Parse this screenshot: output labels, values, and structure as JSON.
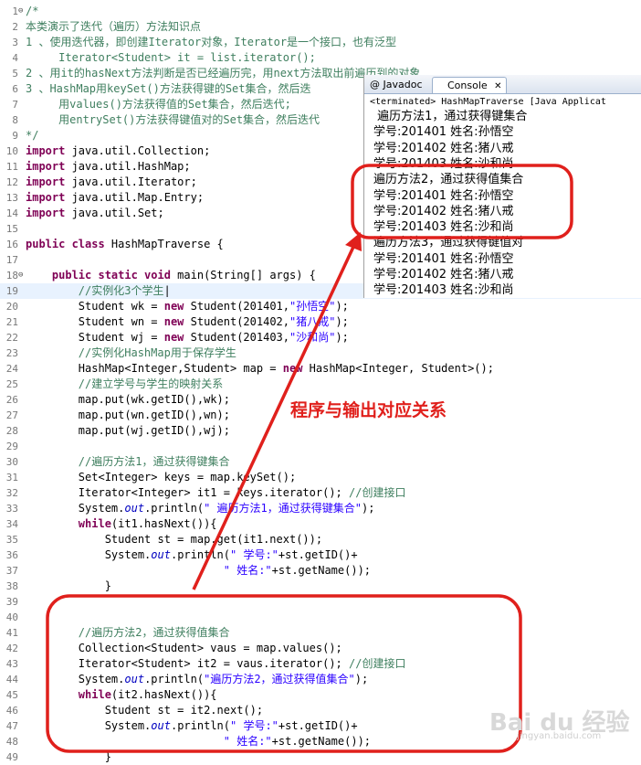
{
  "editor": {
    "lines": [
      {
        "n": "1",
        "fold": "⊖",
        "segs": [
          [
            "cm",
            "/*"
          ]
        ]
      },
      {
        "n": "2",
        "segs": [
          [
            "cm",
            "本类演示了迭代（遍历）方法知识点"
          ]
        ]
      },
      {
        "n": "3",
        "segs": [
          [
            "cm",
            "1 、使用迭代器，即创建Iterator对象，Iterator是一个接口，也有泛型"
          ]
        ]
      },
      {
        "n": "4",
        "segs": [
          [
            "cm",
            "     Iterator<Student> it = list.iterator();"
          ]
        ]
      },
      {
        "n": "5",
        "segs": [
          [
            "cm",
            "2 、用it的hasNext方法判断是否已经遍历完，用next方法取出前遍历到的对象"
          ]
        ]
      },
      {
        "n": "6",
        "segs": [
          [
            "cm",
            "3 、HashMap用keySet()方法获得键的Set集合，然后迭"
          ]
        ]
      },
      {
        "n": "7",
        "segs": [
          [
            "cm",
            "     用values()方法获得值的Set集合，然后迭代;"
          ]
        ]
      },
      {
        "n": "8",
        "segs": [
          [
            "cm",
            "     用entrySet()方法获得键值对的Set集合，然后迭代"
          ]
        ]
      },
      {
        "n": "9",
        "segs": [
          [
            "cm",
            "*/"
          ]
        ]
      },
      {
        "n": "10",
        "segs": [
          [
            "kw",
            "import"
          ],
          [
            "tx",
            " java.util.Collection;"
          ]
        ]
      },
      {
        "n": "11",
        "segs": [
          [
            "kw",
            "import"
          ],
          [
            "tx",
            " java.util.HashMap;"
          ]
        ]
      },
      {
        "n": "12",
        "segs": [
          [
            "kw",
            "import"
          ],
          [
            "tx",
            " java.util.Iterator;"
          ]
        ]
      },
      {
        "n": "13",
        "segs": [
          [
            "kw",
            "import"
          ],
          [
            "tx",
            " java.util.Map.Entry;"
          ]
        ]
      },
      {
        "n": "14",
        "segs": [
          [
            "kw",
            "import"
          ],
          [
            "tx",
            " java.util.Set;"
          ]
        ]
      },
      {
        "n": "15",
        "segs": []
      },
      {
        "n": "16",
        "segs": [
          [
            "kw",
            "public class"
          ],
          [
            "tx",
            " HashMapTraverse {"
          ]
        ]
      },
      {
        "n": "17",
        "segs": []
      },
      {
        "n": "18",
        "fold": "⊖",
        "segs": [
          [
            "tx",
            "    "
          ],
          [
            "kw",
            "public static void"
          ],
          [
            "tx",
            " main(String[] args) {"
          ]
        ]
      },
      {
        "n": "19",
        "current": true,
        "segs": [
          [
            "cm",
            "        //实例化3个学生"
          ],
          [
            "tx",
            "|"
          ]
        ]
      },
      {
        "n": "20",
        "segs": [
          [
            "tx",
            "        Student wk = "
          ],
          [
            "kw",
            "new"
          ],
          [
            "tx",
            " Student(201401,"
          ],
          [
            "str",
            "\"孙悟空\""
          ],
          [
            "tx",
            ");"
          ]
        ]
      },
      {
        "n": "21",
        "segs": [
          [
            "tx",
            "        Student wn = "
          ],
          [
            "kw",
            "new"
          ],
          [
            "tx",
            " Student(201402,"
          ],
          [
            "str",
            "\"猪八戒\""
          ],
          [
            "tx",
            ");"
          ]
        ]
      },
      {
        "n": "22",
        "segs": [
          [
            "tx",
            "        Student wj = "
          ],
          [
            "kw",
            "new"
          ],
          [
            "tx",
            " Student(201403,"
          ],
          [
            "str",
            "\"沙和尚\""
          ],
          [
            "tx",
            ");"
          ]
        ]
      },
      {
        "n": "23",
        "segs": [
          [
            "cm",
            "        //实例化HashMap用于保存学生"
          ]
        ]
      },
      {
        "n": "24",
        "segs": [
          [
            "tx",
            "        HashMap<Integer,Student> map = "
          ],
          [
            "kw",
            "new"
          ],
          [
            "tx",
            " HashMap<Integer, Student>();"
          ]
        ]
      },
      {
        "n": "25",
        "segs": [
          [
            "cm",
            "        //建立学号与学生的映射关系"
          ]
        ]
      },
      {
        "n": "26",
        "segs": [
          [
            "tx",
            "        map.put(wk.getID(),wk);"
          ]
        ]
      },
      {
        "n": "27",
        "segs": [
          [
            "tx",
            "        map.put(wn.getID(),wn);"
          ]
        ]
      },
      {
        "n": "28",
        "segs": [
          [
            "tx",
            "        map.put(wj.getID(),wj);"
          ]
        ]
      },
      {
        "n": "29",
        "segs": []
      },
      {
        "n": "30",
        "segs": [
          [
            "cm",
            "        //遍历方法1，通过获得键集合"
          ]
        ]
      },
      {
        "n": "31",
        "segs": [
          [
            "tx",
            "        Set<Integer> keys = map.keySet();"
          ]
        ]
      },
      {
        "n": "32",
        "segs": [
          [
            "tx",
            "        Iterator<Integer> it1 = keys.iterator(); "
          ],
          [
            "cm",
            "//创建接口"
          ]
        ]
      },
      {
        "n": "33",
        "segs": [
          [
            "tx",
            "        System."
          ],
          [
            "it",
            "out"
          ],
          [
            "tx",
            ".println("
          ],
          [
            "str",
            "\" 遍历方法1，通过获得键集合\""
          ],
          [
            "tx",
            ");"
          ]
        ]
      },
      {
        "n": "34",
        "segs": [
          [
            "tx",
            "        "
          ],
          [
            "kw",
            "while"
          ],
          [
            "tx",
            "(it1.hasNext()){"
          ]
        ]
      },
      {
        "n": "35",
        "segs": [
          [
            "tx",
            "            Student st = map.get(it1.next());"
          ]
        ]
      },
      {
        "n": "36",
        "segs": [
          [
            "tx",
            "            System."
          ],
          [
            "it",
            "out"
          ],
          [
            "tx",
            ".println("
          ],
          [
            "str",
            "\" 学号:\""
          ],
          [
            "tx",
            "+st.getID()+"
          ]
        ]
      },
      {
        "n": "37",
        "segs": [
          [
            "tx",
            "                              "
          ],
          [
            "str",
            "\" 姓名:\""
          ],
          [
            "tx",
            "+st.getName());"
          ]
        ]
      },
      {
        "n": "38",
        "segs": [
          [
            "tx",
            "            }"
          ]
        ]
      },
      {
        "n": "39",
        "segs": []
      },
      {
        "n": "40",
        "segs": []
      },
      {
        "n": "41",
        "segs": [
          [
            "cm",
            "        //遍历方法2，通过获得值集合"
          ]
        ]
      },
      {
        "n": "42",
        "segs": [
          [
            "tx",
            "        Collection<Student> vaus = map.values();"
          ]
        ]
      },
      {
        "n": "43",
        "segs": [
          [
            "tx",
            "        Iterator<Student> it2 = vaus.iterator(); "
          ],
          [
            "cm",
            "//创建接口"
          ]
        ]
      },
      {
        "n": "44",
        "segs": [
          [
            "tx",
            "        System."
          ],
          [
            "it",
            "out"
          ],
          [
            "tx",
            ".println("
          ],
          [
            "str",
            "\"遍历方法2，通过获得值集合\""
          ],
          [
            "tx",
            ");"
          ]
        ]
      },
      {
        "n": "45",
        "segs": [
          [
            "tx",
            "        "
          ],
          [
            "kw",
            "while"
          ],
          [
            "tx",
            "(it2.hasNext()){"
          ]
        ]
      },
      {
        "n": "46",
        "segs": [
          [
            "tx",
            "            Student st = it2.next();"
          ]
        ]
      },
      {
        "n": "47",
        "segs": [
          [
            "tx",
            "            System."
          ],
          [
            "it",
            "out"
          ],
          [
            "tx",
            ".println("
          ],
          [
            "str",
            "\" 学号:\""
          ],
          [
            "tx",
            "+st.getID()+"
          ]
        ]
      },
      {
        "n": "48",
        "segs": [
          [
            "tx",
            "                              "
          ],
          [
            "str",
            "\" 姓名:\""
          ],
          [
            "tx",
            "+st.getName());"
          ]
        ]
      },
      {
        "n": "49",
        "segs": [
          [
            "tx",
            "            }"
          ]
        ]
      }
    ]
  },
  "console": {
    "tab_javadoc": "@ Javadoc",
    "tab_console": "Console",
    "tab_close": "✕",
    "terminated": "<terminated> HashMapTraverse [Java Applicat",
    "lines": [
      " 遍历方法1，通过获得键集合",
      "学号:201401 姓名:孙悟空",
      "学号:201402 姓名:猪八戒",
      "学号:201403 姓名:沙和尚",
      "遍历方法2，通过获得值集合",
      "学号:201401 姓名:孙悟空",
      "学号:201402 姓名:猪八戒",
      "学号:201403 姓名:沙和尚",
      "遍历方法3，通过获得键值对",
      "学号:201401 姓名:孙悟空",
      "学号:201402 姓名:猪八戒",
      "学号:201403 姓名:沙和尚"
    ]
  },
  "annotation": {
    "label": "程序与输出对应关系",
    "color": "#e0201c"
  },
  "watermark": {
    "text": "Bai du 经验",
    "sub": "jingyan.baidu.com"
  }
}
